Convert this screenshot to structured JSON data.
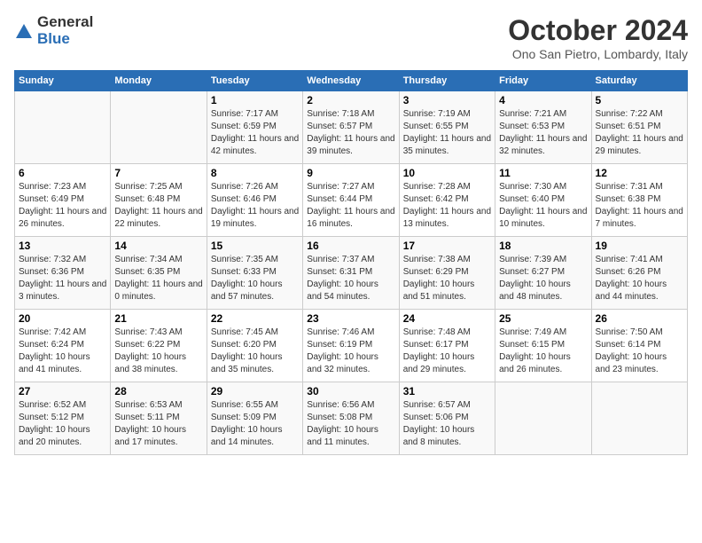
{
  "header": {
    "logo_general": "General",
    "logo_blue": "Blue",
    "month_title": "October 2024",
    "location": "Ono San Pietro, Lombardy, Italy"
  },
  "weekdays": [
    "Sunday",
    "Monday",
    "Tuesday",
    "Wednesday",
    "Thursday",
    "Friday",
    "Saturday"
  ],
  "weeks": [
    [
      {
        "day": "",
        "info": ""
      },
      {
        "day": "",
        "info": ""
      },
      {
        "day": "1",
        "info": "Sunrise: 7:17 AM\nSunset: 6:59 PM\nDaylight: 11 hours and 42 minutes."
      },
      {
        "day": "2",
        "info": "Sunrise: 7:18 AM\nSunset: 6:57 PM\nDaylight: 11 hours and 39 minutes."
      },
      {
        "day": "3",
        "info": "Sunrise: 7:19 AM\nSunset: 6:55 PM\nDaylight: 11 hours and 35 minutes."
      },
      {
        "day": "4",
        "info": "Sunrise: 7:21 AM\nSunset: 6:53 PM\nDaylight: 11 hours and 32 minutes."
      },
      {
        "day": "5",
        "info": "Sunrise: 7:22 AM\nSunset: 6:51 PM\nDaylight: 11 hours and 29 minutes."
      }
    ],
    [
      {
        "day": "6",
        "info": "Sunrise: 7:23 AM\nSunset: 6:49 PM\nDaylight: 11 hours and 26 minutes."
      },
      {
        "day": "7",
        "info": "Sunrise: 7:25 AM\nSunset: 6:48 PM\nDaylight: 11 hours and 22 minutes."
      },
      {
        "day": "8",
        "info": "Sunrise: 7:26 AM\nSunset: 6:46 PM\nDaylight: 11 hours and 19 minutes."
      },
      {
        "day": "9",
        "info": "Sunrise: 7:27 AM\nSunset: 6:44 PM\nDaylight: 11 hours and 16 minutes."
      },
      {
        "day": "10",
        "info": "Sunrise: 7:28 AM\nSunset: 6:42 PM\nDaylight: 11 hours and 13 minutes."
      },
      {
        "day": "11",
        "info": "Sunrise: 7:30 AM\nSunset: 6:40 PM\nDaylight: 11 hours and 10 minutes."
      },
      {
        "day": "12",
        "info": "Sunrise: 7:31 AM\nSunset: 6:38 PM\nDaylight: 11 hours and 7 minutes."
      }
    ],
    [
      {
        "day": "13",
        "info": "Sunrise: 7:32 AM\nSunset: 6:36 PM\nDaylight: 11 hours and 3 minutes."
      },
      {
        "day": "14",
        "info": "Sunrise: 7:34 AM\nSunset: 6:35 PM\nDaylight: 11 hours and 0 minutes."
      },
      {
        "day": "15",
        "info": "Sunrise: 7:35 AM\nSunset: 6:33 PM\nDaylight: 10 hours and 57 minutes."
      },
      {
        "day": "16",
        "info": "Sunrise: 7:37 AM\nSunset: 6:31 PM\nDaylight: 10 hours and 54 minutes."
      },
      {
        "day": "17",
        "info": "Sunrise: 7:38 AM\nSunset: 6:29 PM\nDaylight: 10 hours and 51 minutes."
      },
      {
        "day": "18",
        "info": "Sunrise: 7:39 AM\nSunset: 6:27 PM\nDaylight: 10 hours and 48 minutes."
      },
      {
        "day": "19",
        "info": "Sunrise: 7:41 AM\nSunset: 6:26 PM\nDaylight: 10 hours and 44 minutes."
      }
    ],
    [
      {
        "day": "20",
        "info": "Sunrise: 7:42 AM\nSunset: 6:24 PM\nDaylight: 10 hours and 41 minutes."
      },
      {
        "day": "21",
        "info": "Sunrise: 7:43 AM\nSunset: 6:22 PM\nDaylight: 10 hours and 38 minutes."
      },
      {
        "day": "22",
        "info": "Sunrise: 7:45 AM\nSunset: 6:20 PM\nDaylight: 10 hours and 35 minutes."
      },
      {
        "day": "23",
        "info": "Sunrise: 7:46 AM\nSunset: 6:19 PM\nDaylight: 10 hours and 32 minutes."
      },
      {
        "day": "24",
        "info": "Sunrise: 7:48 AM\nSunset: 6:17 PM\nDaylight: 10 hours and 29 minutes."
      },
      {
        "day": "25",
        "info": "Sunrise: 7:49 AM\nSunset: 6:15 PM\nDaylight: 10 hours and 26 minutes."
      },
      {
        "day": "26",
        "info": "Sunrise: 7:50 AM\nSunset: 6:14 PM\nDaylight: 10 hours and 23 minutes."
      }
    ],
    [
      {
        "day": "27",
        "info": "Sunrise: 6:52 AM\nSunset: 5:12 PM\nDaylight: 10 hours and 20 minutes."
      },
      {
        "day": "28",
        "info": "Sunrise: 6:53 AM\nSunset: 5:11 PM\nDaylight: 10 hours and 17 minutes."
      },
      {
        "day": "29",
        "info": "Sunrise: 6:55 AM\nSunset: 5:09 PM\nDaylight: 10 hours and 14 minutes."
      },
      {
        "day": "30",
        "info": "Sunrise: 6:56 AM\nSunset: 5:08 PM\nDaylight: 10 hours and 11 minutes."
      },
      {
        "day": "31",
        "info": "Sunrise: 6:57 AM\nSunset: 5:06 PM\nDaylight: 10 hours and 8 minutes."
      },
      {
        "day": "",
        "info": ""
      },
      {
        "day": "",
        "info": ""
      }
    ]
  ]
}
